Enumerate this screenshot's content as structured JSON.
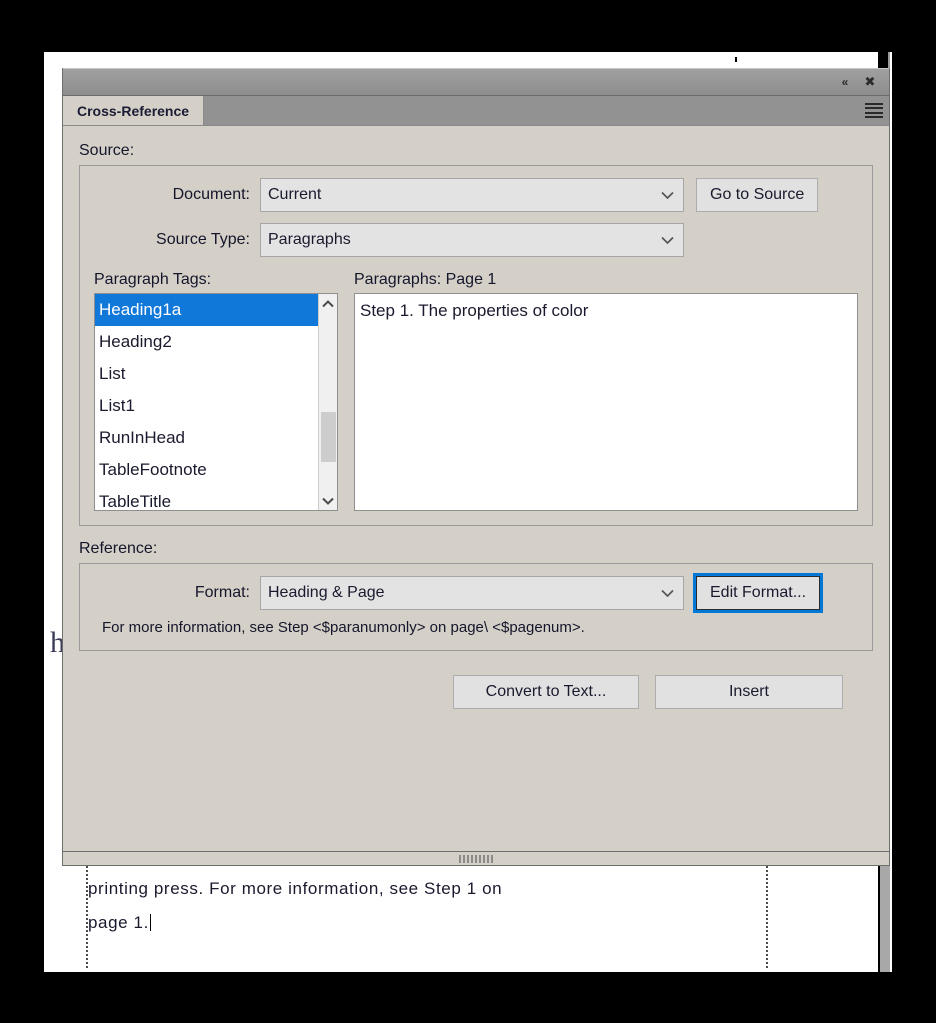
{
  "panel": {
    "tab_label": "Cross-Reference",
    "collapse_glyph": "«",
    "close_glyph": "✖",
    "menu_icon": "hamburger-menu-icon"
  },
  "source": {
    "section_label": "Source:",
    "document_label": "Document:",
    "document_value": "Current",
    "go_to_source_label": "Go to Source",
    "source_type_label": "Source Type:",
    "source_type_value": "Paragraphs",
    "paragraph_tags_caption": "Paragraph Tags:",
    "paragraph_tags": [
      "Heading1a",
      "Heading2",
      "List",
      "List1",
      "RunInHead",
      "TableFootnote",
      "TableTitle"
    ],
    "paragraph_tags_selected": "Heading1a",
    "paragraphs_caption": "Paragraphs: Page  1",
    "paragraphs": [
      "Step 1. The properties of color"
    ]
  },
  "reference": {
    "section_label": "Reference:",
    "format_label": "Format:",
    "format_value": "Heading & Page",
    "edit_format_label": "Edit Format...",
    "format_hint": "For more information, see Step <$paranumonly> on page\\ <$pagenum>."
  },
  "actions": {
    "convert_to_text_label": "Convert to Text...",
    "insert_label": "Insert"
  },
  "document": {
    "line1": "printing press. For more information, see Step 1 on",
    "line2": "page 1.",
    "left_glyph": "h"
  },
  "colors": {
    "accent_selection": "#1078d8",
    "focus_ring": "#0078d7",
    "panel_face": "#d4d0c8",
    "titlebar": "#939393",
    "tabstrip": "#929292"
  }
}
